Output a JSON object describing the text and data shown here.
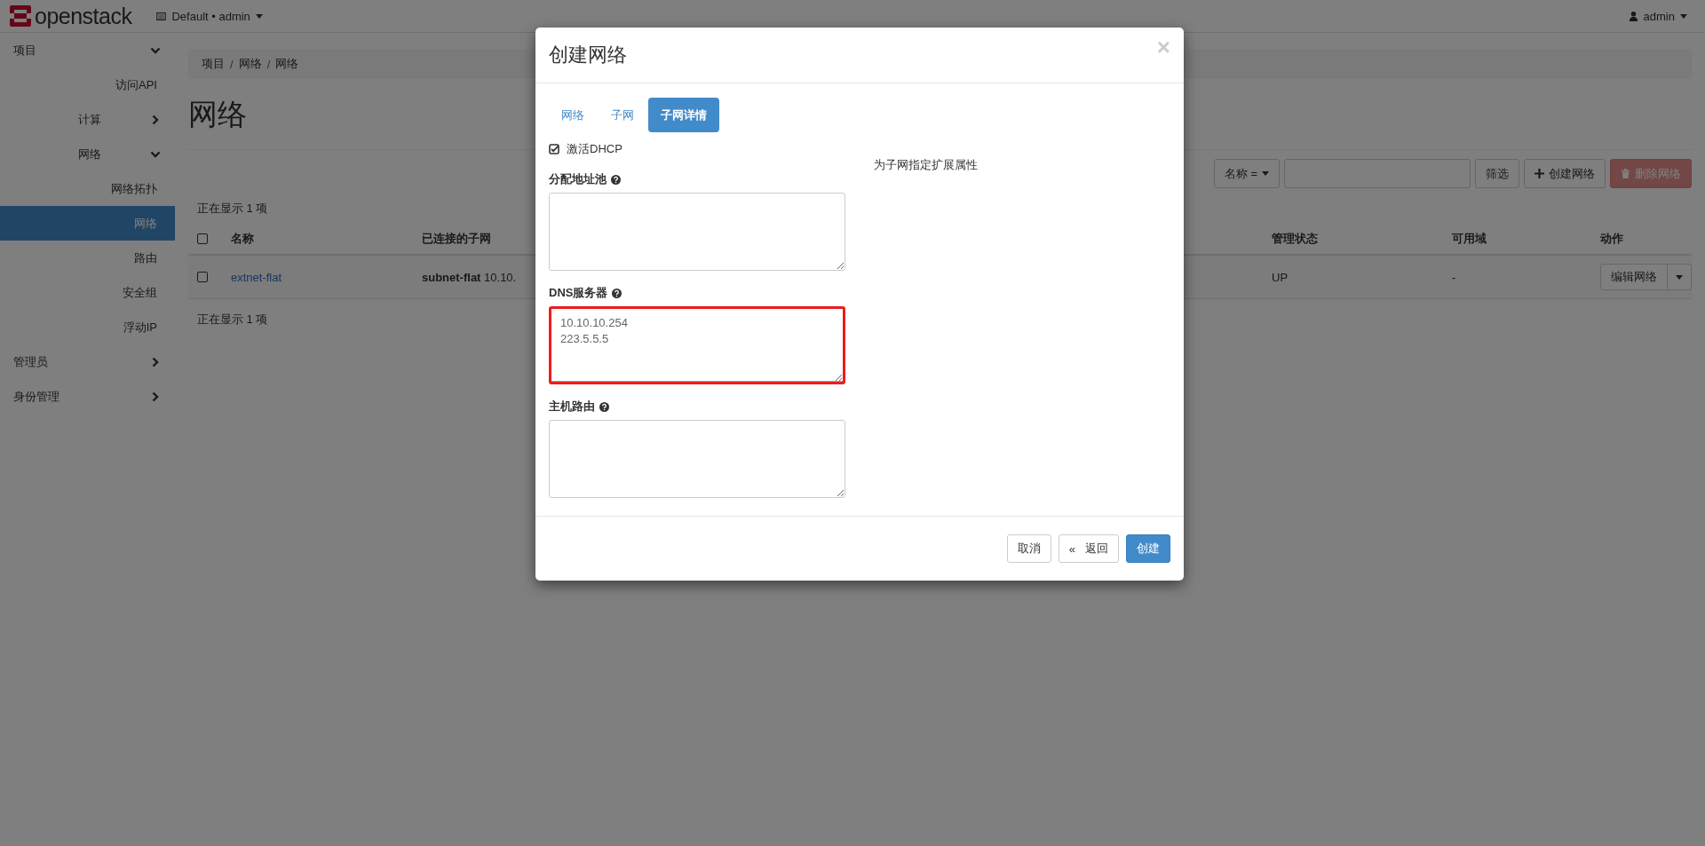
{
  "topbar": {
    "brand": "openstack",
    "project_menu": "Default • admin",
    "user_menu": "admin"
  },
  "sidebar": {
    "items": [
      {
        "label": "项目",
        "expanded": true,
        "selected": false,
        "children": [
          {
            "label": "访问API",
            "selected": false
          },
          {
            "label": "计算",
            "expanded": false,
            "selected": false
          },
          {
            "label": "网络",
            "expanded": true,
            "selected": false,
            "children": [
              {
                "label": "网络拓扑",
                "selected": false
              },
              {
                "label": "网络",
                "selected": true
              },
              {
                "label": "路由",
                "selected": false
              },
              {
                "label": "安全组",
                "selected": false
              },
              {
                "label": "浮动IP",
                "selected": false
              }
            ]
          }
        ]
      },
      {
        "label": "管理员",
        "expanded": false,
        "selected": false
      },
      {
        "label": "身份管理",
        "expanded": false,
        "selected": false
      }
    ]
  },
  "breadcrumb": [
    "项目",
    "网络",
    "网络"
  ],
  "breadcrumb_separator": "/",
  "page_title": "网络",
  "toolbar": {
    "filter_field": "名称 =",
    "filter_button": "筛选",
    "create_button": "创建网络",
    "delete_button": {
      "label": "删除网络",
      "disabled": true
    }
  },
  "count_top": "正在显示 1 项",
  "table": {
    "header_checked": false,
    "columns": [
      "名称",
      "已连接的子网",
      "管理状态",
      "可用域",
      "动作"
    ],
    "rows": [
      {
        "checked": false,
        "name": "extnet-flat",
        "subnet": "**subnet-flat** 10.10.",
        "admin_state": "UP",
        "availability_zone": "-",
        "action": "编辑网络"
      }
    ]
  },
  "count_bottom": "正在显示 1 项",
  "modal": {
    "title": "创建网络",
    "close": "×",
    "tabs": [
      {
        "label": "网络",
        "selected": false
      },
      {
        "label": "子网",
        "selected": false
      },
      {
        "label": "子网详情",
        "selected": true
      }
    ],
    "dhcp": {
      "label": "激活DHCP",
      "checked": true
    },
    "fields": [
      {
        "label": "分配地址池",
        "highlighted": false
      },
      {
        "label": "DNS服务器",
        "value": "10.10.10.254\n223.5.5.5",
        "highlighted": true
      },
      {
        "label": "主机路由",
        "highlighted": false
      }
    ],
    "help_text": "为子网指定扩展属性",
    "buttons": {
      "cancel": "取消",
      "back_icon": "«",
      "back": "返回",
      "create": "创建"
    }
  }
}
